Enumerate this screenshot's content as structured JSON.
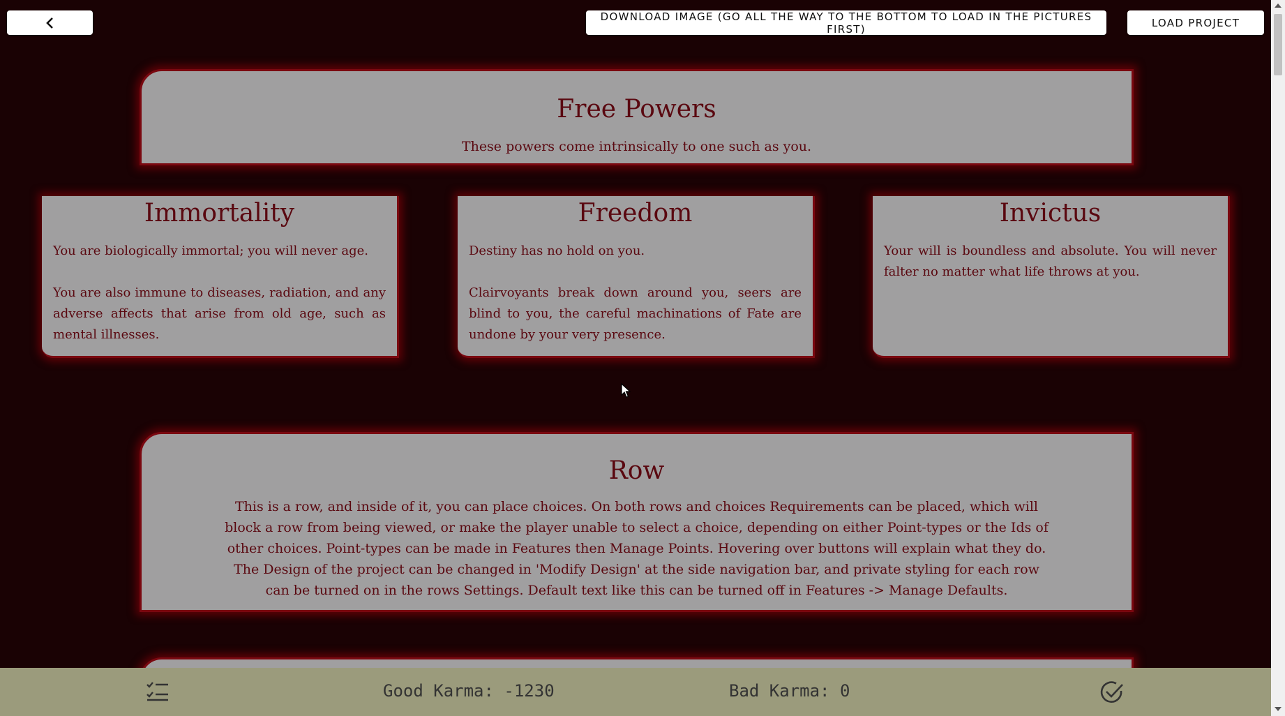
{
  "toolbar": {
    "back_icon": "chevron-left-icon",
    "download_label": "DOWNLOAD IMAGE (GO ALL THE WAY TO THE BOTTOM TO LOAD IN THE PICTURES FIRST)",
    "load_label": "LOAD PROJECT"
  },
  "free_powers": {
    "title": "Free Powers",
    "text": "These powers come intrinsically to one such as you."
  },
  "choices": [
    {
      "title": "Immortality",
      "paragraphs": [
        "You are biologically immortal; you will never age.",
        "You are also immune to diseases, radiation, and any adverse affects that arise from old age, such as mental illnesses."
      ]
    },
    {
      "title": "Freedom",
      "paragraphs": [
        "Destiny has no hold on you.",
        "Clairvoyants break down around you, seers are blind to you, the careful machinations of Fate are undone by your very presence."
      ]
    },
    {
      "title": "Invictus",
      "paragraphs": [
        "Your will is boundless and absolute. You will never falter no matter what life throws at you."
      ]
    }
  ],
  "row": {
    "title": "Row",
    "text": "This is a row, and inside of it, you can place choices. On both rows and choices Requirements can be placed, which will block a row from being viewed, or make the player unable to select a choice, depending on either Point-types or the Ids of other choices. Point-types can be made in Features then Manage Points. Hovering over buttons will explain what they do. The Design of the project can be changed in 'Modify Design' at the side navigation bar, and private styling for each row can be turned on in the rows Settings. Default text like this can be turned off in Features -> Manage Defaults."
  },
  "bottom_bar": {
    "good_karma": "Good Karma: -1230",
    "bad_karma": "Bad Karma: 0",
    "list_icon": "checklist-icon",
    "check_icon": "check-circle-icon"
  },
  "colors": {
    "background": "#1a0204",
    "card": "#a09fa0",
    "card_border": "#7a0810",
    "text": "#5a0810",
    "bottom_bar": "#9b9b7c"
  }
}
